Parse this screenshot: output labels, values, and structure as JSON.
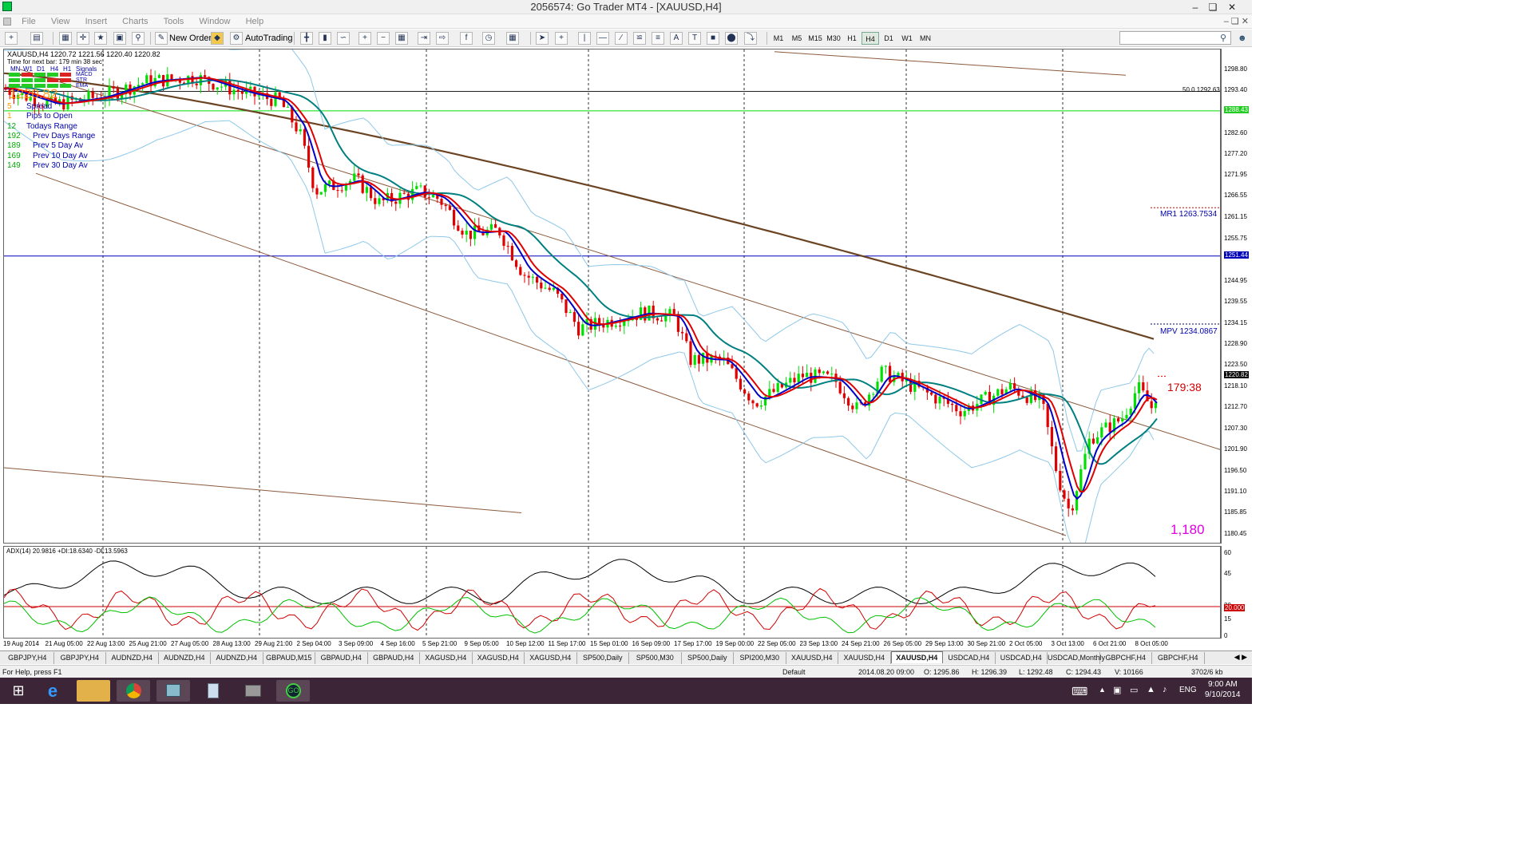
{
  "window": {
    "title": "2056574: Go Trader MT4 - [XAUUSD,H4]"
  },
  "menu": [
    "File",
    "View",
    "Insert",
    "Charts",
    "Tools",
    "Window",
    "Help"
  ],
  "toolbar": {
    "new_order": "New Order",
    "autotrading": "AutoTrading"
  },
  "timeframes": [
    "M1",
    "M5",
    "M15",
    "M30",
    "H1",
    "H4",
    "D1",
    "W1",
    "MN"
  ],
  "active_timeframe": "H4",
  "chart": {
    "header": "XAUUSD,H4  1220.72 1221.56 1220.40 1220.82",
    "time_for_bar": "Time for next bar: 179 min 38 sec",
    "signal_labels": [
      "MN",
      "W1",
      "D1",
      "H4",
      "H1",
      "Signals"
    ],
    "signal_rows": [
      "MACD",
      "STR",
      "EMA"
    ],
    "price_big": "1220.82",
    "stats": [
      {
        "value": "5",
        "label": "Spread"
      },
      {
        "value": "1",
        "label": "Pips to Open"
      },
      {
        "value": "12",
        "label": "Todays Range"
      },
      {
        "value": "192",
        "label": "Prev Days Range"
      },
      {
        "value": "189",
        "label": "Prev 5 Day Av"
      },
      {
        "value": "169",
        "label": "Prev 10 Day Av"
      },
      {
        "value": "149",
        "label": "Prev 30 Day Av"
      }
    ],
    "fib_label": "50.0  1292.63",
    "mr1_label": "MR1   1263.7534",
    "mpv_label": "MPV   1234.0867",
    "countdown": "179:38",
    "big_level": "1,180",
    "green_level": "1288.43",
    "blue_level": "1251.44",
    "current_price": "1220.82"
  },
  "price_axis": [
    "1298.80",
    "1293.40",
    "1288.43",
    "1282.60",
    "1277.20",
    "1271.95",
    "1266.55",
    "1261.15",
    "1255.75",
    "1251.44",
    "1244.95",
    "1239.55",
    "1234.15",
    "1228.90",
    "1223.50",
    "1220.82",
    "1218.10",
    "1212.70",
    "1207.30",
    "1201.90",
    "1196.50",
    "1191.10",
    "1185.85",
    "1180.45"
  ],
  "adx": {
    "header": "ADX(14) 20.9816 +DI:18.6340 -DI:13.5963",
    "axis": [
      "60",
      "45",
      "30",
      "20.000",
      "15",
      "0"
    ]
  },
  "time_axis": [
    "19 Aug 2014",
    "21 Aug 05:00",
    "22 Aug 13:00",
    "25 Aug 21:00",
    "27 Aug 05:00",
    "28 Aug 13:00",
    "29 Aug 21:00",
    "2 Sep 04:00",
    "3 Sep 09:00",
    "4 Sep 16:00",
    "5 Sep 21:00",
    "9 Sep 05:00",
    "10 Sep 12:00",
    "11 Sep 17:00",
    "15 Sep 01:00",
    "16 Sep 09:00",
    "17 Sep 17:00",
    "19 Sep 00:00",
    "22 Sep 05:00",
    "23 Sep 13:00",
    "24 Sep 21:00",
    "26 Sep 05:00",
    "29 Sep 13:00",
    "30 Sep 21:00",
    "2 Oct 05:00",
    "3 Oct 13:00",
    "6 Oct 21:00",
    "8 Oct 05:00"
  ],
  "tabs": [
    "GBPJPY,H4",
    "GBPJPY,H4",
    "AUDNZD,H4",
    "AUDNZD,H4",
    "AUDNZD,H4",
    "GBPAUD,M15",
    "GBPAUD,H4",
    "GBPAUD,H4",
    "XAGUSD,H4",
    "XAGUSD,H4",
    "XAGUSD,H4",
    "SP500,Daily",
    "SP500,M30",
    "SP500,Daily",
    "SPI200,M30",
    "XAUUSD,H4",
    "XAUUSD,H4",
    "XAUUSD,H4",
    "USDCAD,H4",
    "USDCAD,H4",
    "USDCAD,Monthly",
    "GBPCHF,H4",
    "GBPCHF,H4"
  ],
  "active_tab": "XAUUSD,H4",
  "status": {
    "help": "For Help, press F1",
    "profile": "Default",
    "datetime": "2014.08.20 09:00",
    "open": "O: 1295.86",
    "high": "H: 1296.39",
    "low": "L: 1292.48",
    "close": "C: 1294.43",
    "volume": "V: 10166",
    "traffic": "3702/6 kb"
  },
  "taskbar": {
    "lang": "ENG",
    "time": "9:00 AM",
    "date": "9/10/2014"
  },
  "colors": {
    "bull": "#00e000",
    "bear": "#e00000",
    "ema_fast": "#e00000",
    "ema_mid": "#0000c8",
    "ema_slow": "#008080",
    "bollinger": "#8ec8e8",
    "ma_long": "#6b4423",
    "channel": "#8b5a3c",
    "adx_main": "#000000",
    "di_plus": "#00c000",
    "di_minus": "#d00000"
  }
}
